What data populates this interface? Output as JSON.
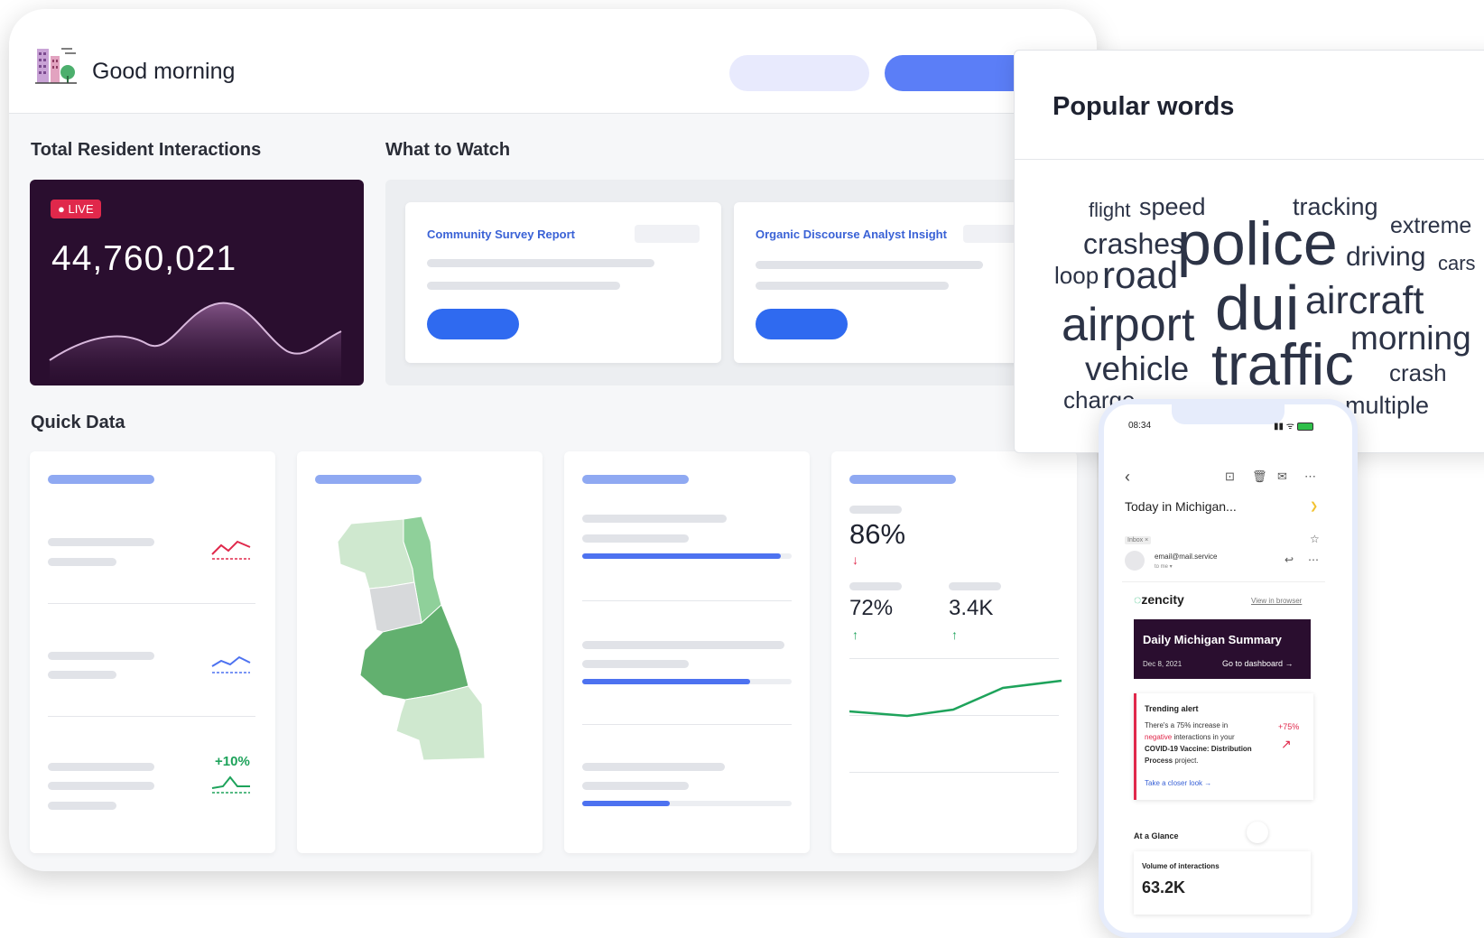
{
  "header": {
    "greeting": "Good morning"
  },
  "sections": {
    "total_interactions": "Total Resident Interactions",
    "what_to_watch": "What to Watch",
    "quick_data": "Quick Data"
  },
  "live_card": {
    "badge": "LIVE",
    "value": "44,760,021"
  },
  "watch_cards": [
    {
      "title": "Community Survey Report"
    },
    {
      "title": "Organic Discourse Analyst Insight"
    }
  ],
  "quick_data": {
    "trend_label": "+10%",
    "stat_main": "86%",
    "stat_a": "72%",
    "stat_b": "3.4K",
    "progress": [
      0.95,
      0.8,
      0.42
    ]
  },
  "popular_words": {
    "title": "Popular words",
    "words": [
      "flight",
      "speed",
      "tracking",
      "extreme",
      "crashes",
      "police",
      "driving",
      "cars",
      "loop",
      "road",
      "airport",
      "dui",
      "aircraft",
      "morning",
      "vehicle",
      "traffic",
      "crash",
      "charge",
      "multiple"
    ]
  },
  "phone": {
    "time": "08:34",
    "subject": "Today in Michigan...",
    "inbox_tag": "Inbox ×",
    "sender": "email@mail.service",
    "to_me": "to me ▾",
    "brand": "zencity",
    "view_browser": "View in browser",
    "summary_title": "Daily Michigan Summary",
    "summary_date": "Dec 8, 2021",
    "dashboard_link": "Go to dashboard →",
    "alert_title": "Trending alert",
    "alert_line1": "There's a 75% increase in",
    "alert_neg": "negative",
    "alert_line2": " interactions in your",
    "alert_bold1": "COVID-19 Vaccine: Distribution",
    "alert_bold2": "Process",
    "alert_tail": " project.",
    "alert_pct": "+75%",
    "alert_link": "Take a closer look →",
    "glance": "At a Glance",
    "volume_label": "Volume of interactions",
    "volume_value": "63.2K"
  },
  "colors": {
    "accent": "#5b7ef7",
    "live_bg": "#2a0e2f",
    "green": "#1ea35b",
    "red": "#e0284b"
  }
}
